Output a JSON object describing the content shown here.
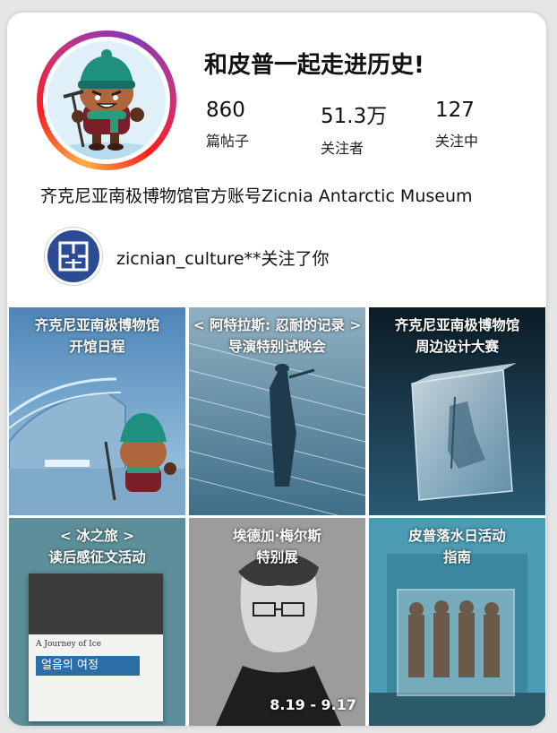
{
  "profile": {
    "title": "和皮普一起走进历史!",
    "bio": "齐克尼亚南极博物馆官方账号Zicnia Antarctic Museum",
    "stats": [
      {
        "value": "860",
        "label": "篇帖子"
      },
      {
        "value": "51.3万",
        "label": "关注者"
      },
      {
        "value": "127",
        "label": "关注中"
      }
    ]
  },
  "followed_by": {
    "text": "zicnian_culture**关注了你"
  },
  "posts": [
    {
      "line1": "齐克尼亚南极博物馆",
      "line2": "开馆日程"
    },
    {
      "line1": "< 阿特拉斯: 忍耐的记录 >",
      "line2": "导演特别试映会"
    },
    {
      "line1": "齐克尼亚南极博物馆",
      "line2": "周边设计大赛"
    },
    {
      "line1": "< 冰之旅 >",
      "line2": "读后感征文活动",
      "book_title": "A Journey of Ice",
      "book_korean": "얼음의 여정"
    },
    {
      "line1": "埃德加·梅尔斯",
      "line2": "特别展",
      "date": "8.19 - 9.17"
    },
    {
      "line1": "皮普落水日活动",
      "line2": "指南"
    }
  ]
}
